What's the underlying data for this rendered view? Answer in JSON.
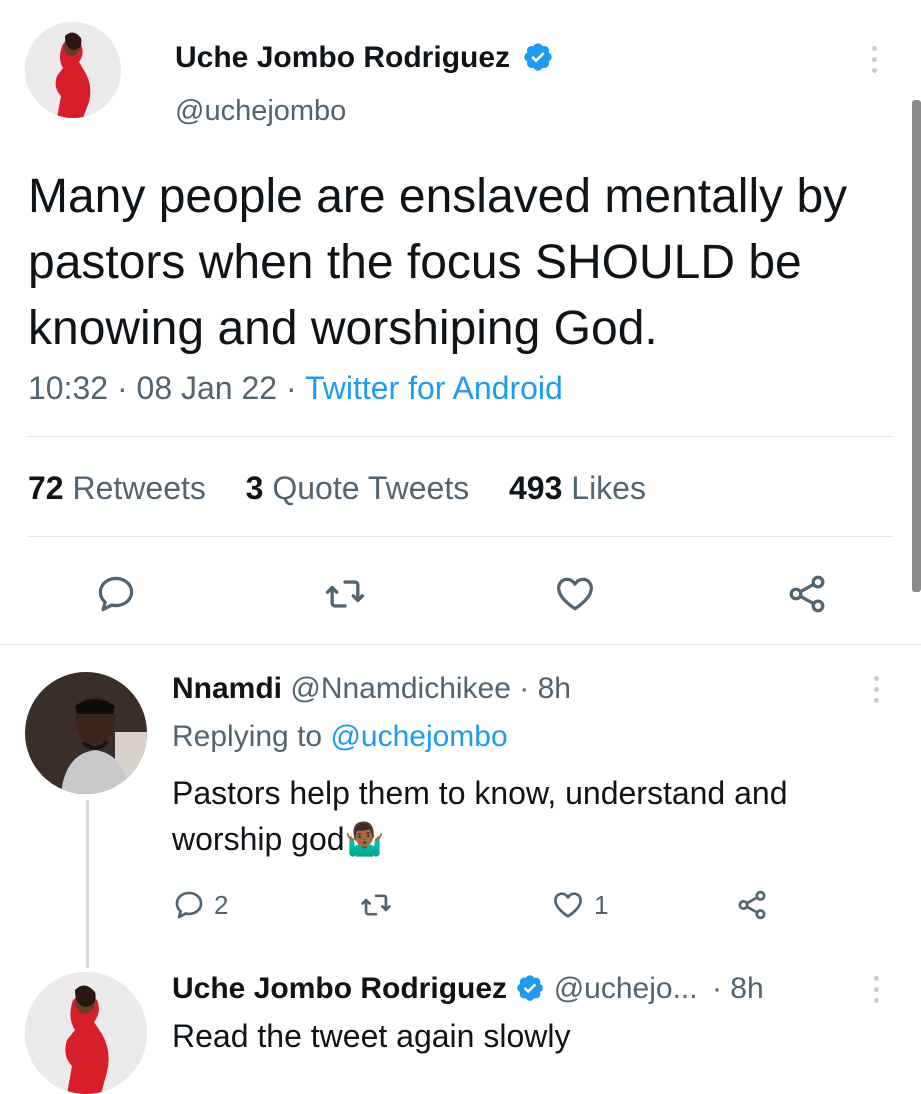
{
  "main_tweet": {
    "author_name": "Uche Jombo Rodriguez",
    "author_handle": "@uchejombo",
    "text": "Many people are enslaved mentally by pastors when the focus SHOULD be knowing and worshiping God.",
    "time": "10:32",
    "date": "08 Jan 22",
    "source": "Twitter for Android",
    "sep": "·",
    "stats": {
      "retweets_count": "72",
      "retweets_label": "Retweets",
      "quotes_count": "3",
      "quotes_label": "Quote Tweets",
      "likes_count": "493",
      "likes_label": "Likes"
    }
  },
  "reply1": {
    "author_name": "Nnamdi",
    "author_handle": "@Nnamdichikee",
    "time": "· 8h",
    "replying_prefix": "Replying to",
    "replying_handle": "@uchejombo",
    "text": "Pastors help them to know, understand and worship god",
    "emoji": "🤷🏾‍♂️",
    "reply_count": "2",
    "like_count": "1"
  },
  "reply2": {
    "author_name": "Uche Jombo Rodriguez",
    "author_handle": "@uchejo...",
    "time": "· 8h",
    "text": "Read the tweet again slowly"
  },
  "colors": {
    "accent": "#1d9bf0",
    "text": "#0f1419",
    "secondary": "#536471"
  }
}
